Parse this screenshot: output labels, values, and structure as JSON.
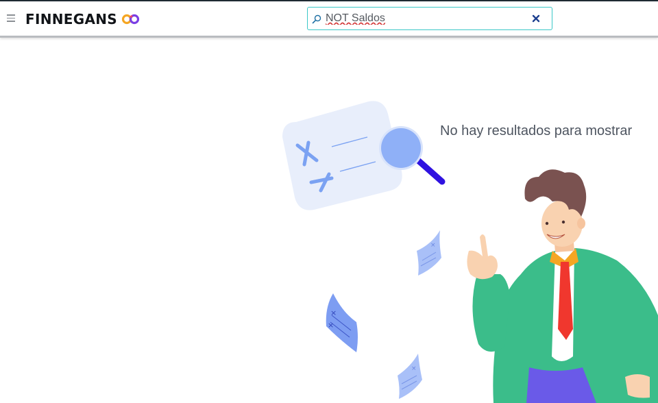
{
  "header": {
    "brand": "FINNEGANS",
    "search": {
      "value": "NOT Saldos",
      "placeholder": ""
    }
  },
  "main": {
    "empty_message": "No hay resultados para mostrar"
  },
  "icons": {
    "menu": "hamburger-menu-icon",
    "brand_mark": "infinity-logo-icon",
    "search": "magnifier-icon",
    "clear": "close-x-icon"
  },
  "colors": {
    "search_border": "#39c7c7",
    "clear_icon": "#1d3f8f",
    "logo_orange": "#f5a623",
    "logo_purple": "#7b3fe4",
    "illustration_blue": "#8fb0f7",
    "jacket_green": "#3bbd8a",
    "tie_red": "#f0372e"
  }
}
